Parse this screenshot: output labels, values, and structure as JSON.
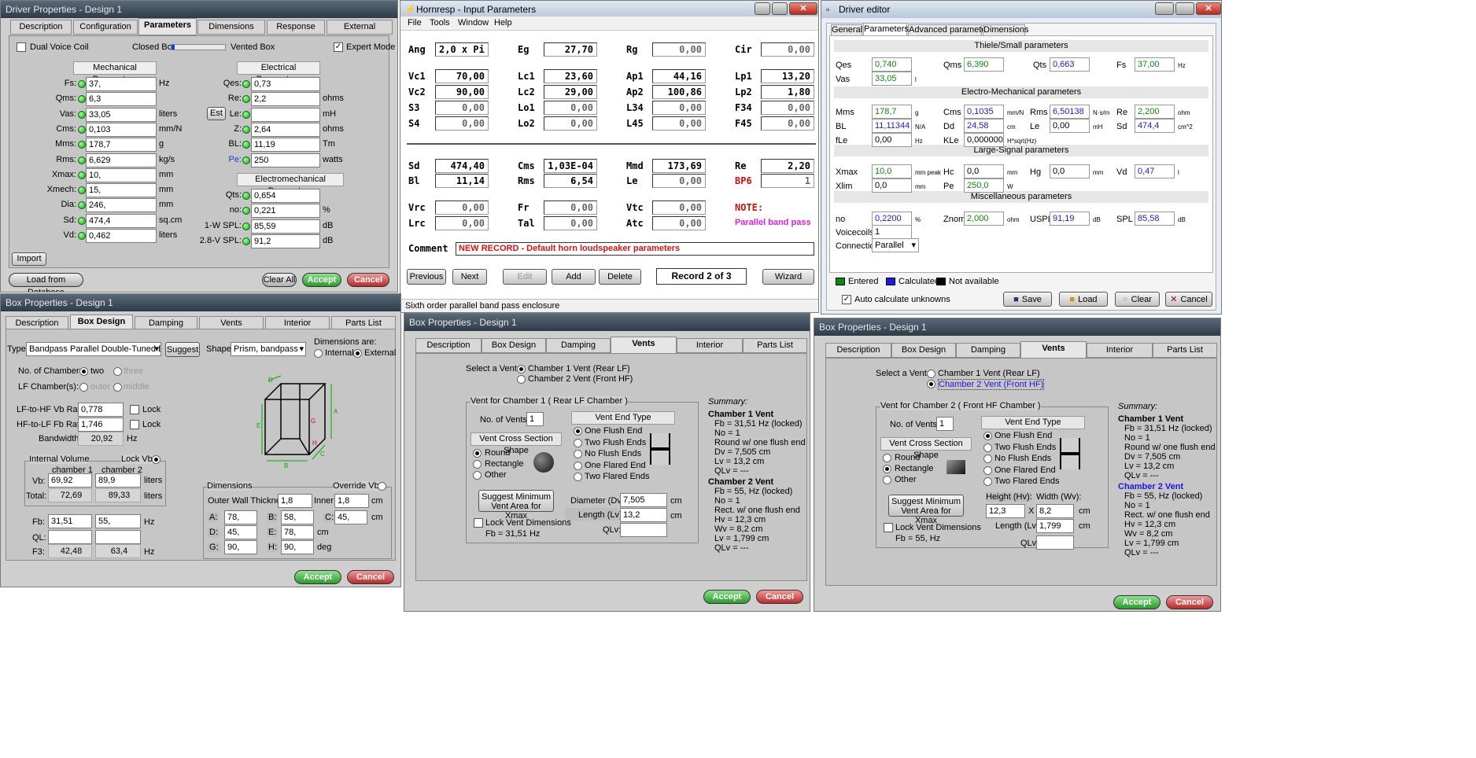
{
  "dp": {
    "title": "Driver Properties - Design 1",
    "tabs": [
      "Description",
      "Configuration",
      "Parameters",
      "Dimensions",
      "Response",
      "External"
    ],
    "active_tab": "Parameters",
    "dual": "Dual Voice Coil",
    "closed": "Closed Box",
    "vented": "Vented Box",
    "expert": "Expert Mode",
    "mech_hdr": "Mechanical Parameters",
    "elec_hdr": "Electrical Parameters",
    "em_hdr": "Electromechanical Parameters",
    "est": "Est",
    "import": "Import",
    "load_db": "Load from Database",
    "clear": "Clear All",
    "accept": "Accept",
    "cancel": "Cancel",
    "mech": [
      {
        "l": "Fs:",
        "v": "37,",
        "u": "Hz"
      },
      {
        "l": "Qms:",
        "v": "6,3",
        "u": ""
      },
      {
        "l": "Vas:",
        "v": "33,05",
        "u": "liters"
      },
      {
        "l": "Cms:",
        "v": "0,103",
        "u": "mm/N"
      },
      {
        "l": "Mms:",
        "v": "178,7",
        "u": "g"
      },
      {
        "l": "Rms:",
        "v": "6,629",
        "u": "kg/s"
      },
      {
        "l": "Xmax:",
        "v": "10,",
        "u": "mm"
      },
      {
        "l": "Xmech:",
        "v": "15,",
        "u": "mm"
      },
      {
        "l": "Dia:",
        "v": "246,",
        "u": "mm"
      },
      {
        "l": "Sd:",
        "v": "474,4",
        "u": "sq.cm"
      },
      {
        "l": "Vd:",
        "v": "0,462",
        "u": "liters"
      }
    ],
    "elec": [
      {
        "l": "Qes:",
        "v": "0,73",
        "u": ""
      },
      {
        "l": "Re:",
        "v": "2,2",
        "u": "ohms"
      },
      {
        "l": "Le:",
        "v": "",
        "u": "mH"
      },
      {
        "l": "Z:",
        "v": "2,64",
        "u": "ohms"
      },
      {
        "l": "BL:",
        "v": "11,19",
        "u": "Tm"
      },
      {
        "l": "Pe:",
        "v": "250",
        "u": "watts"
      }
    ],
    "em": [
      {
        "l": "Qts:",
        "v": "0,654",
        "u": ""
      },
      {
        "l": "no:",
        "v": "0,221",
        "u": "%"
      },
      {
        "l": "1-W SPL:",
        "v": "85,59",
        "u": "dB"
      },
      {
        "l": "2.8-V SPL:",
        "v": "91,2",
        "u": "dB"
      }
    ]
  },
  "hr": {
    "title": "Hornresp - Input Parameters",
    "menu": [
      "File",
      "Tools",
      "Window",
      "Help"
    ],
    "r1": [
      {
        "l": "Ang",
        "v": "2,0 x Pi"
      },
      {
        "l": "Eg",
        "v": "27,70"
      },
      {
        "l": "Rg",
        "v": "0,00"
      },
      {
        "l": "Cir",
        "v": "0,00"
      }
    ],
    "r2": [
      {
        "l": "Vc1",
        "v": "70,00"
      },
      {
        "l": "Lc1",
        "v": "23,60"
      },
      {
        "l": "Ap1",
        "v": "44,16"
      },
      {
        "l": "Lp1",
        "v": "13,20"
      }
    ],
    "r3": [
      {
        "l": "Vc2",
        "v": "90,00"
      },
      {
        "l": "Lc2",
        "v": "29,00"
      },
      {
        "l": "Ap2",
        "v": "100,86"
      },
      {
        "l": "Lp2",
        "v": "1,80"
      }
    ],
    "r4": [
      {
        "l": "S3",
        "v": "0,00"
      },
      {
        "l": "Lo1",
        "v": "0,00"
      },
      {
        "l": "L34",
        "v": "0,00"
      },
      {
        "l": "F34",
        "v": "0,00"
      }
    ],
    "r5": [
      {
        "l": "S4",
        "v": "0,00"
      },
      {
        "l": "Lo2",
        "v": "0,00"
      },
      {
        "l": "L45",
        "v": "0,00"
      },
      {
        "l": "F45",
        "v": "0,00"
      }
    ],
    "r6": [
      {
        "l": "Sd",
        "v": "474,40"
      },
      {
        "l": "Cms",
        "v": "1,03E-04"
      },
      {
        "l": "Mmd",
        "v": "173,69"
      },
      {
        "l": "Re",
        "v": "2,20"
      }
    ],
    "r7": [
      {
        "l": "Bl",
        "v": "11,14"
      },
      {
        "l": "Rms",
        "v": "6,54"
      },
      {
        "l": "Le",
        "v": "0,00"
      },
      {
        "l": "BP6",
        "v": "1"
      }
    ],
    "r8": [
      {
        "l": "Vrc",
        "v": "0,00"
      },
      {
        "l": "Fr",
        "v": "0,00"
      },
      {
        "l": "Vtc",
        "v": "0,00"
      },
      {
        "l": "NOTE:",
        "v": ""
      }
    ],
    "r9": [
      {
        "l": "Lrc",
        "v": "0,00"
      },
      {
        "l": "Tal",
        "v": "0,00"
      },
      {
        "l": "Atc",
        "v": "0,00"
      }
    ],
    "note": "Parallel band pass",
    "comment_l": "Comment",
    "comment": "NEW RECORD - Default horn loudspeaker parameters",
    "prev": "Previous",
    "next": "Next",
    "edit": "Edit",
    "add": "Add",
    "delete": "Delete",
    "record": "Record 2 of 3",
    "wizard": "Wizard",
    "status": "Sixth order parallel band pass enclosure"
  },
  "de": {
    "title": "Driver editor",
    "tabs": [
      "General",
      "Parameters",
      "Advanced parameters",
      "Dimensions"
    ],
    "active": "Parameters",
    "ts": "Thiele/Small parameters",
    "emp": "Electro-Mechanical parameters",
    "ls": "Large-Signal parameters",
    "misc": "Miscellaneous parameters",
    "qes": "0,740",
    "qms": "6,390",
    "qts": "0,663",
    "fs": "37,00",
    "vas": "33,05",
    "mms": "178,7",
    "cms": "0,1035",
    "rms": "6,50138",
    "re": "2,200",
    "bl": "11,11344",
    "dd": "24,58",
    "le": "0,00",
    "sd": "474,4",
    "fle": "0,00",
    "kle": "0,000000",
    "xmax": "10,0",
    "hc": "0,0",
    "hg": "0,0",
    "vd": "0,47",
    "xlim": "0,0",
    "pe": "250,0",
    "no": "0,2200",
    "znom": "2,000",
    "uspl": "91,19",
    "spl": "85,58",
    "vc": "1",
    "conn": "Parallel",
    "u_hz": "Hz",
    "u_l": "l",
    "u_g": "g",
    "u_mmn": "mm/N",
    "u_nsm": "N·s/m",
    "u_ohm": "ohm",
    "u_na": "N/A",
    "u_cm": "cm",
    "u_mh": "mH",
    "u_cm2": "cm^2",
    "u_hsq": "H*sqrt(Hz)",
    "u_mmpk": "mm peak",
    "u_mm": "mm",
    "u_w": "W",
    "u_pct": "%",
    "u_db": "dB",
    "entered": "Entered",
    "calc": "Calculated",
    "na": "Not available",
    "auto": "Auto calculate unknowns",
    "save": "Save",
    "load": "Load",
    "clear": "Clear",
    "cancel": "Cancel"
  },
  "bp1": {
    "title": "Box Properties - Design 1",
    "tabs": [
      "Description",
      "Box Design",
      "Damping",
      "Vents",
      "Interior",
      "Parts List"
    ],
    "type_l": "Type:",
    "type": "Bandpass Parallel Double-Tuned Box",
    "suggest": "Suggest",
    "shape_l": "Shape:",
    "shape": "Prism, bandpass",
    "dims_are": "Dimensions are:",
    "internal": "Internal",
    "external": "External",
    "nch": "No. of Chambers:",
    "two": "two",
    "three": "three",
    "lfc": "LF Chamber(s):",
    "outer": "outer",
    "middle": "middle",
    "lfhf": "LF-to-HF Vb Ratio:",
    "lfhf_v": "0,778",
    "hflf": "HF-to-LF Fb Ratio:",
    "hflf_v": "1,746",
    "lock": "Lock",
    "bw": "Bandwidth:",
    "bw_v": "20,92",
    "hz": "Hz",
    "iv": "Internal Volume",
    "lockvb": "Lock Vb",
    "ch1": "chamber 1",
    "ch2": "chamber 2",
    "vb": "Vb:",
    "vb1": "69,92",
    "vb2": "89,9",
    "liters": "liters",
    "total": "Total:",
    "t1": "72,69",
    "t2": "89,33",
    "fb": "Fb:",
    "fb1": "31,51",
    "fb2": "55,",
    "ql": "QL:",
    "f3": "F3:",
    "f31": "42,48",
    "f32": "63,4",
    "dims": "Dimensions",
    "override": "Override Vb",
    "owt": "Outer Wall Thickness:",
    "owt_v": "1,8",
    "inner": "Inner:",
    "inner_v": "1,8",
    "cm": "cm",
    "deg": "deg",
    "d": [
      {
        "l": "A:",
        "v": "78,"
      },
      {
        "l": "B:",
        "v": "58,"
      },
      {
        "l": "C:",
        "v": "45,"
      },
      {
        "l": "D:",
        "v": "45,"
      },
      {
        "l": "E:",
        "v": "78,"
      },
      {
        "l": "G:",
        "v": "90,"
      },
      {
        "l": "H:",
        "v": "90,"
      }
    ],
    "accept": "Accept",
    "cancel": "Cancel"
  },
  "bp2": {
    "title": "Box Properties - Design 1",
    "tabs": [
      "Description",
      "Box Design",
      "Damping",
      "Vents",
      "Interior",
      "Parts List"
    ],
    "sel": "Select a Vent:",
    "v1": "Chamber 1 Vent (Rear LF)",
    "v2": "Chamber 2 Vent (Front HF)",
    "group": "Vent for Chamber 1  ( Rear LF Chamber )",
    "nov": "No. of Vents:",
    "nov_v": "1",
    "vcs": "Vent Cross Section Shape",
    "round": "Round",
    "rect": "Rectangle",
    "other": "Other",
    "vet": "Vent End Type",
    "e1": "One Flush End",
    "e2": "Two Flush Ends",
    "e3": "No Flush Ends",
    "e4": "One Flared End",
    "e5": "Two Flared Ends",
    "sugmin": "Suggest Minimum Vent Area for Xmax",
    "diam": "Diameter (Dv):",
    "diam_v": "7,505",
    "len": "Length (Lv):",
    "len_v": "13,2",
    "qlv": "QLv:",
    "cm": "cm",
    "lockvd": "Lock Vent Dimensions",
    "fbl": "Fb = 31,51 Hz",
    "summary": "Summary:",
    "s1h": "Chamber 1 Vent",
    "s1": [
      "Fb = 31,51 Hz  (locked)",
      "No = 1",
      "Round w/ one flush end",
      "Dv = 7,505 cm",
      "Lv = 13,2 cm",
      "QLv = ---"
    ],
    "s2h": "Chamber 2 Vent",
    "s2": [
      "Fb = 55, Hz  (locked)",
      "No = 1",
      "Rect. w/ one flush end",
      "Hv = 12,3 cm",
      "Wv = 8,2 cm",
      "Lv = 1,799 cm",
      "QLv = ---"
    ],
    "accept": "Accept",
    "cancel": "Cancel"
  },
  "bp3": {
    "title": "Box Properties - Design 1",
    "group": "Vent for Chamber 2  ( Front HF Chamber )",
    "h": "Height (Hv):",
    "w": "Width (Wv):",
    "h_v": "12,3",
    "w_v": "8,2",
    "x": "X",
    "len_v": "1,799",
    "fbl": "Fb = 55, Hz"
  }
}
